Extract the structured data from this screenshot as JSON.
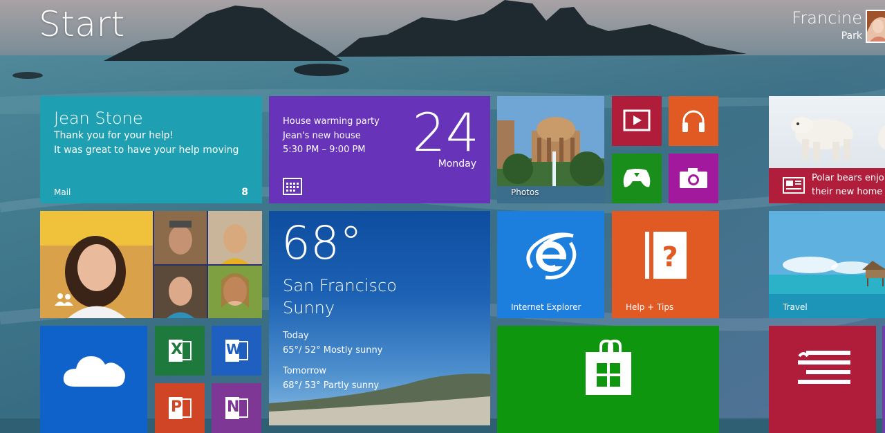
{
  "screen": {
    "title": "Start"
  },
  "user": {
    "first_name": "Francine",
    "last_name": "Park"
  },
  "tiles": {
    "mail": {
      "from": "Jean Stone",
      "line1": "Thank you for your help!",
      "line2": "It was great to have your help moving",
      "label": "Mail",
      "count": "8"
    },
    "calendar": {
      "event": "House warming party",
      "location": "Jean's new house",
      "time": "5:30 PM – 9:00 PM",
      "day": "24",
      "weekday": "Monday"
    },
    "photos": {
      "label": "Photos"
    },
    "video": {
      "icon": "video-play-icon"
    },
    "music": {
      "icon": "headphones-icon"
    },
    "games": {
      "icon": "xbox-controller-icon"
    },
    "camera": {
      "icon": "camera-icon"
    },
    "news": {
      "headline_line1": "Polar bears enjo",
      "headline_line2": "their new home"
    },
    "people": {
      "icon": "people-icon"
    },
    "weather": {
      "temperature": "68°",
      "city": "San Francisco",
      "condition": "Sunny",
      "today_label": "Today",
      "today_forecast": "65°/ 52° Mostly sunny",
      "tomorrow_label": "Tomorrow",
      "tomorrow_forecast": "68°/ 53° Partly sunny"
    },
    "internet_explorer": {
      "label": "Internet Explorer"
    },
    "help_tips": {
      "label": "Help + Tips"
    },
    "travel": {
      "label": "Travel"
    },
    "onedrive": {
      "icon": "cloud-icon"
    },
    "excel": {
      "letter": "X"
    },
    "word": {
      "letter": "W"
    },
    "powerpoint": {
      "letter": "P"
    },
    "onenote": {
      "letter": "N"
    },
    "store": {
      "icon": "store-bag-icon"
    },
    "reading_list": {
      "icon": "reading-list-icon"
    }
  },
  "colors": {
    "mail": "#1fa0b2",
    "calendar": "#6733b8",
    "video": "#b01d3b",
    "music": "#e25a23",
    "games": "#1a8e1a",
    "camera": "#a3199e",
    "internet_explorer": "#1d7fdd",
    "help_tips": "#e25a23",
    "onedrive": "#0f62c9",
    "store": "#0f960f"
  }
}
